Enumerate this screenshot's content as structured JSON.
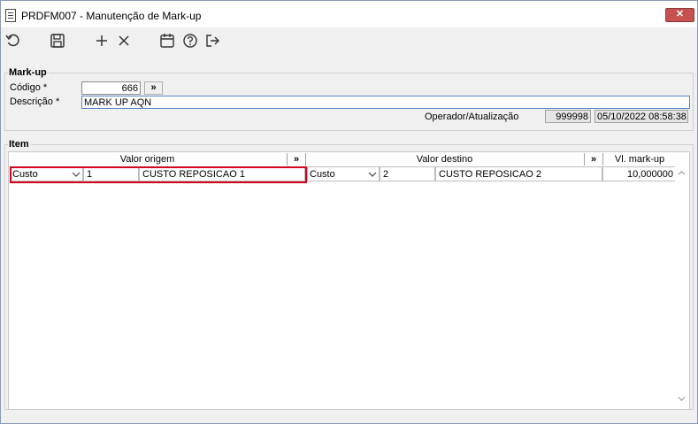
{
  "window": {
    "title": "PRDFM007 - Manutenção de Mark-up",
    "close_label": "✕"
  },
  "toolbar": {
    "buttons": [
      "undo-icon",
      "save-icon",
      "add-icon",
      "delete-icon",
      "calendar-icon",
      "help-icon",
      "exit-icon"
    ]
  },
  "markup": {
    "legend": "Mark-up",
    "codigo_label": "Código *",
    "codigo_value": "666",
    "lookup_label": "»",
    "descricao_label": "Descrição *",
    "descricao_value": "MARK UP AQN",
    "operador_label": "Operador/Atualização",
    "operador_value": "999998",
    "atualizacao_value": "05/10/2022 08:58:38"
  },
  "item": {
    "legend": "Item",
    "headers": {
      "valor_origem": "Valor origem",
      "origem_btn": "»",
      "valor_destino": "Valor destino",
      "destino_btn": "»",
      "vl_markup": "Vl. mark-up"
    },
    "rows": [
      {
        "origem_tipo": "Custo",
        "origem_codigo": "1",
        "origem_desc": "CUSTO REPOSICAO 1",
        "destino_tipo": "Custo",
        "destino_codigo": "2",
        "destino_desc": "CUSTO REPOSICAO 2",
        "vl_markup": "10,000000"
      }
    ]
  },
  "colors": {
    "selection_border": "#d0021b",
    "close_button": "#c75050"
  }
}
